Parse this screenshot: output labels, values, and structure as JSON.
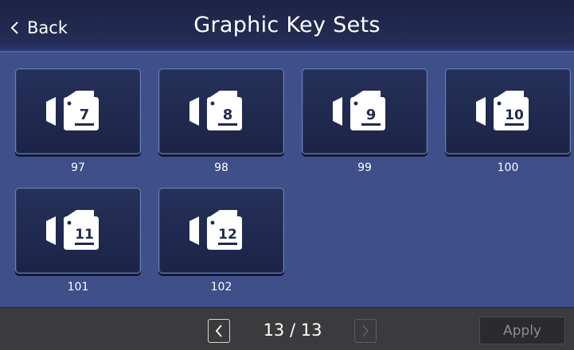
{
  "header": {
    "back_label": "Back",
    "title": "Graphic Key Sets"
  },
  "tiles": [
    {
      "number": "7",
      "label": "97",
      "icon": "camera-key-icon"
    },
    {
      "number": "8",
      "label": "98",
      "icon": "camera-key-icon"
    },
    {
      "number": "9",
      "label": "99",
      "icon": "camera-key-icon"
    },
    {
      "number": "10",
      "label": "100",
      "icon": "camera-key-icon"
    },
    {
      "number": "11",
      "label": "101",
      "icon": "camera-key-icon"
    },
    {
      "number": "12",
      "label": "102",
      "icon": "camera-key-icon"
    }
  ],
  "footer": {
    "page_indicator": "13 / 13",
    "apply_label": "Apply",
    "prev_icon": "chevron-left-icon",
    "next_icon": "chevron-right-icon"
  },
  "colors": {
    "header_bg": "#1d2343",
    "main_bg": "#3e4f89",
    "tile_bg": "#1f2a4e",
    "footer_bg": "#3b3b3e",
    "apply_text": "#8e8e92"
  }
}
